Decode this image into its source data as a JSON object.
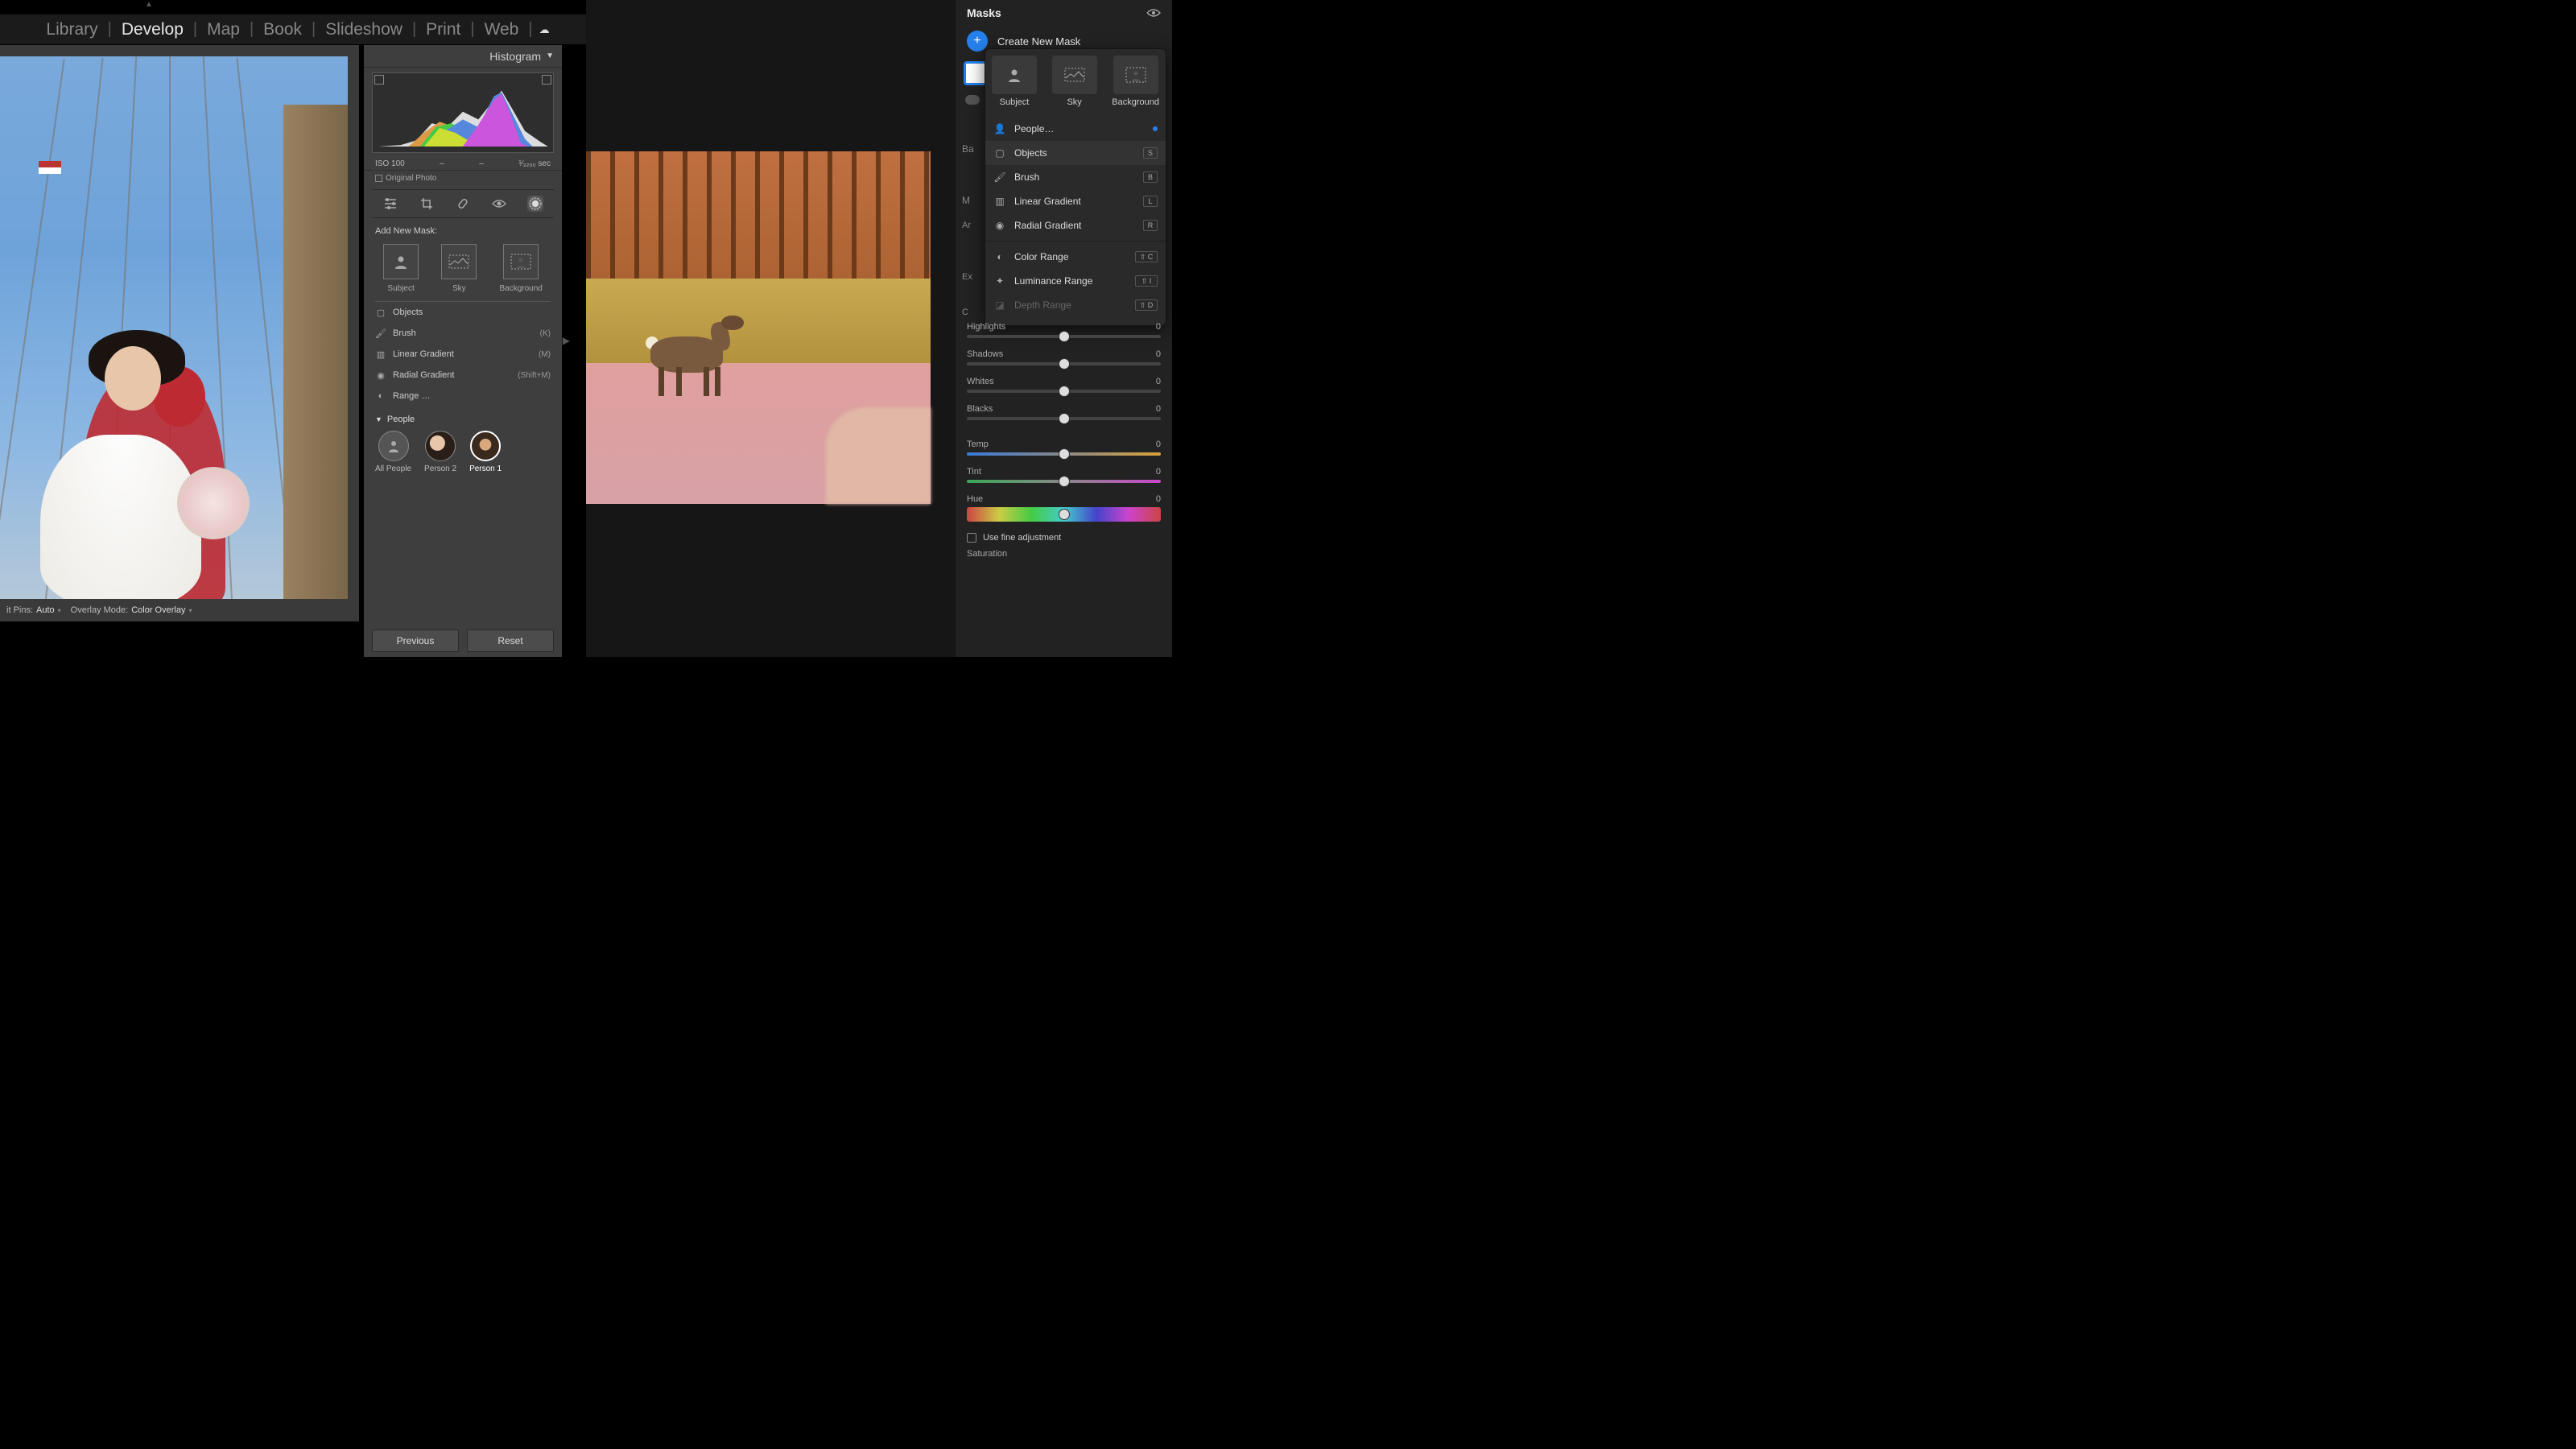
{
  "left_app": {
    "modules": [
      "Library",
      "Develop",
      "Map",
      "Book",
      "Slideshow",
      "Print",
      "Web"
    ],
    "active_module": "Develop",
    "histogram": {
      "title": "Histogram",
      "iso": "ISO 100",
      "fstop": "–",
      "focal": "–",
      "shutter": "¹⁄₃₂₀₀ sec",
      "original": "Original Photo"
    },
    "mask_section": "Add New Mask:",
    "mask_tiles": [
      {
        "label": "Subject"
      },
      {
        "label": "Sky"
      },
      {
        "label": "Background"
      }
    ],
    "mask_rows": [
      {
        "label": "Objects",
        "shortcut": ""
      },
      {
        "label": "Brush",
        "shortcut": "(K)"
      },
      {
        "label": "Linear Gradient",
        "shortcut": "(M)"
      },
      {
        "label": "Radial Gradient",
        "shortcut": "(Shift+M)"
      },
      {
        "label": "Range …",
        "shortcut": ""
      }
    ],
    "people_header": "People",
    "people": [
      {
        "label": "All People"
      },
      {
        "label": "Person 2"
      },
      {
        "label": "Person 1"
      }
    ],
    "footer": {
      "pins_label": "it Pins:",
      "pins_value": "Auto",
      "overlay_label": "Overlay Mode:",
      "overlay_value": "Color Overlay"
    },
    "buttons": {
      "previous": "Previous",
      "reset": "Reset"
    }
  },
  "right_app": {
    "panel_title": "Masks",
    "create_label": "Create New Mask",
    "partial_labels": {
      "ba": "Ba",
      "m": "M"
    },
    "popup_tiles": [
      {
        "label": "Subject"
      },
      {
        "label": "Sky"
      },
      {
        "label": "Background"
      }
    ],
    "popup_rows": [
      {
        "label": "People…",
        "hint": "dot"
      },
      {
        "label": "Objects",
        "key": "S"
      },
      {
        "label": "Brush",
        "key": "B"
      },
      {
        "label": "Linear Gradient",
        "key": "L"
      },
      {
        "label": "Radial Gradient",
        "key": "R"
      },
      {
        "label": "Color Range",
        "key": "⇧ C"
      },
      {
        "label": "Luminance Range",
        "key": "⇧ I"
      },
      {
        "label": "Depth Range",
        "key": "⇧ D",
        "disabled": true
      }
    ],
    "sliders": [
      {
        "label": "Highlights",
        "value": "0",
        "track": "plain"
      },
      {
        "label": "Shadows",
        "value": "0",
        "track": "plain"
      },
      {
        "label": "Whites",
        "value": "0",
        "track": "plain"
      },
      {
        "label": "Blacks",
        "value": "0",
        "track": "plain"
      },
      {
        "label": "Temp",
        "value": "0",
        "track": "temp"
      },
      {
        "label": "Tint",
        "value": "0",
        "track": "tint"
      },
      {
        "label": "Hue",
        "value": "0",
        "track": "hue"
      }
    ],
    "peek": {
      "c": "C",
      "a": "Ar",
      "e": "Ex"
    },
    "checkbox": "Use fine adjustment",
    "last_label": "Saturation"
  }
}
